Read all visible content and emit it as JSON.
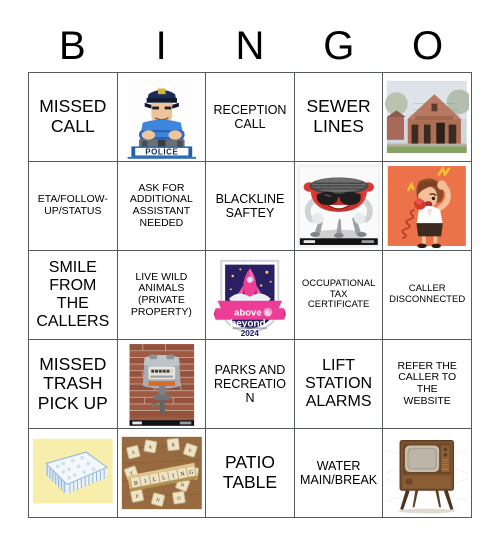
{
  "card": {
    "title": "BINGO",
    "header_letters": [
      "B",
      "I",
      "N",
      "G",
      "O"
    ],
    "grid_size": "5x5",
    "border_color": "#555a5e",
    "text_color": "#000000",
    "background_color": "#ffffff"
  },
  "cells": [
    {
      "row": 1,
      "col": 1,
      "type": "text",
      "text": "MISSED CALL",
      "lines": [
        "MISSED",
        "CALL"
      ],
      "size": "t-xl"
    },
    {
      "row": 1,
      "col": 2,
      "type": "image",
      "image_name": "police-officer-illustration",
      "caption": "POLICE",
      "alt": "Cartoon police officer with arms crossed wearing a blue uniform and cap, standing above a POLICE sign"
    },
    {
      "row": 1,
      "col": 3,
      "type": "text",
      "text": "RECEPTION CALL",
      "lines": [
        "RECEPTION",
        "CALL"
      ],
      "size": "t-md"
    },
    {
      "row": 1,
      "col": 4,
      "type": "text",
      "text": "SEWER LINES",
      "lines": [
        "SEWER",
        "LINES"
      ],
      "size": "t-xl"
    },
    {
      "row": 1,
      "col": 5,
      "type": "image",
      "image_name": "brick-civic-building-photo",
      "caption": "",
      "alt": "Photograph of a red brick civic building with a gabled roof, tall windows and a green lawn"
    },
    {
      "row": 2,
      "col": 1,
      "type": "text",
      "text": "ETA/FOLLOW-UP/STATUS",
      "lines": [
        "ETA/FOLLOW-",
        "UP/STATUS"
      ],
      "size": "t-sm"
    },
    {
      "row": 2,
      "col": 2,
      "type": "text",
      "text": "ASK FOR ADDITIONAL ASSISTANT NEEDED",
      "lines": [
        "ASK FOR",
        "ADDITIONAL",
        "ASSISTANT",
        "NEEDED"
      ],
      "size": "t-sm"
    },
    {
      "row": 2,
      "col": 3,
      "type": "text",
      "text": "BLACKLINE SAFTEY",
      "lines": [
        "BLACKLINE",
        "SAFTEY"
      ],
      "size": "t-md"
    },
    {
      "row": 2,
      "col": 4,
      "type": "image",
      "image_name": "bbq-grill-cartoon",
      "caption": "",
      "alt": "Red cartoon barbecue grill character wearing black sunglasses, smiling, with arms and three legs"
    },
    {
      "row": 2,
      "col": 5,
      "type": "image",
      "image_name": "angry-woman-on-phone-illustration",
      "caption": "",
      "alt": "Illustration of an angry woman yelling into a red corded telephone on an orange background"
    },
    {
      "row": 3,
      "col": 1,
      "type": "text",
      "text": "SMILE FROM THE CALLERS",
      "lines": [
        "SMILE",
        "FROM",
        "THE",
        "CALLERS"
      ],
      "size": "t-lg"
    },
    {
      "row": 3,
      "col": 2,
      "type": "text",
      "text": "LIVE WILD ANIMALS (PRIVATE PROPERTY)",
      "lines": [
        "LIVE WILD",
        "ANIMALS",
        "(PRIVATE",
        "PROPERTY)"
      ],
      "size": "t-sm"
    },
    {
      "row": 3,
      "col": 3,
      "type": "image",
      "image_name": "above-and-beyond-award-badge",
      "caption": "above & beyond 2024",
      "alt": "Round award badge with a pink rocket on a dark blue starry sky and a pink banner reading above and beyond, dated 2024"
    },
    {
      "row": 3,
      "col": 4,
      "type": "text",
      "text": "OCCUPATIONAL TAX CERTIFICATE",
      "lines": [
        "OCCUPATIONAL",
        "TAX",
        "CERTIFICATE"
      ],
      "size": "t-xs"
    },
    {
      "row": 3,
      "col": 5,
      "type": "text",
      "text": "CALLER DISCONNECTED",
      "lines": [
        "CALLER",
        "DISCONNECTED"
      ],
      "size": "t-xs"
    },
    {
      "row": 4,
      "col": 1,
      "type": "text",
      "text": "MISSED TRASH PICK UP",
      "lines": [
        "MISSED",
        "TRASH",
        "PICK UP"
      ],
      "size": "t-xl"
    },
    {
      "row": 4,
      "col": 2,
      "type": "image",
      "image_name": "utility-meter-photo",
      "caption": "",
      "alt": "Photograph of a grey gas or water utility meter mounted on a red brick wall"
    },
    {
      "row": 4,
      "col": 3,
      "type": "text",
      "text": "PARKS AND RECREATION",
      "lines": [
        "PARKS AND",
        "RECREATION"
      ],
      "size": "t-md"
    },
    {
      "row": 4,
      "col": 4,
      "type": "text",
      "text": "LIFT STATION ALARMS",
      "lines": [
        "LIFT",
        "STATION",
        "ALARMS"
      ],
      "size": "t-lg"
    },
    {
      "row": 4,
      "col": 5,
      "type": "text",
      "text": "REFER THE CALLER TO THE WEBSITE",
      "lines": [
        "REFER THE",
        "CALLER TO",
        "THE",
        "WEBSITE"
      ],
      "size": "t-sm"
    },
    {
      "row": 5,
      "col": 1,
      "type": "image",
      "image_name": "mattress-illustration",
      "caption": "",
      "alt": "Illustration of a white tufted mattress with blue striped sides on a pale yellow background"
    },
    {
      "row": 5,
      "col": 2,
      "type": "image",
      "image_name": "billing-scrabble-tiles-photo",
      "caption": "BILLING",
      "alt": "Photograph of wooden letter tiles on a rack spelling BILLING with scattered tiles on a wooden table"
    },
    {
      "row": 5,
      "col": 3,
      "type": "text",
      "text": "PATIO TABLE",
      "lines": [
        "PATIO",
        "TABLE"
      ],
      "size": "t-xl"
    },
    {
      "row": 5,
      "col": 4,
      "type": "text",
      "text": "WATER MAIN/BREAK",
      "lines": [
        "WATER",
        "MAIN/BREAK"
      ],
      "size": "t-md"
    },
    {
      "row": 5,
      "col": 5,
      "type": "image",
      "image_name": "vintage-television-photo",
      "caption": "",
      "alt": "Photograph of a vintage wooden console television set standing on four slanted legs"
    }
  ]
}
